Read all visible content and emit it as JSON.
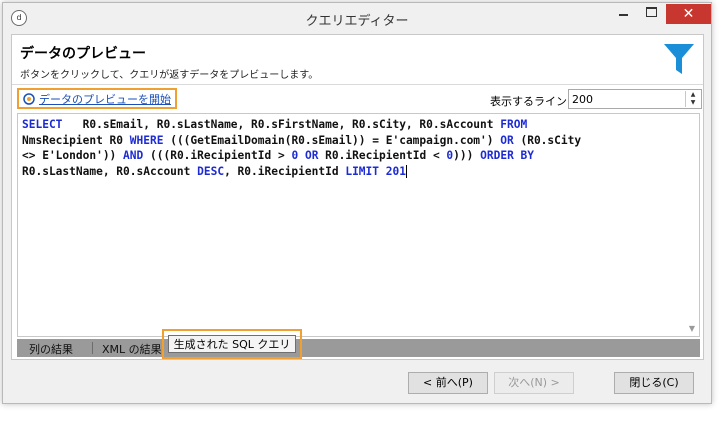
{
  "window": {
    "title": "クエリエディター",
    "app_icon_glyph": "d"
  },
  "header": {
    "title": "データのプレビュー",
    "subtitle": "ボタンをクリックして、クエリが返すデータをプレビューします。",
    "icon": "filter-icon",
    "icon_color": "#1a8fd8"
  },
  "toolbar": {
    "preview_label": "データのプレビューを開始",
    "lines_label": "表示するライン:",
    "lines_value": "200",
    "highlight_color": "#f0a030"
  },
  "sql": {
    "line1_a": "SELECT",
    "line1_b": "   R0.sEmail, R0.sLastName, R0.sFirstName, R0.sCity, R0.sAccount ",
    "line1_c": "FROM",
    "line2_a": "NmsRecipient R0 ",
    "line2_b": "WHERE",
    "line2_c": " (((GetEmailDomain(R0.sEmail)) = E'campaign.com') ",
    "line2_d": "OR",
    "line2_e": " (R0.sCity",
    "line3_a": "<> E'London')) ",
    "line3_b": "AND",
    "line3_c": " (((R0.iRecipientId > ",
    "line3_d": "0",
    "line3_e": " ",
    "line3_f": "OR",
    "line3_g": " R0.iRecipientId < ",
    "line3_h": "0",
    "line3_i": "))) ",
    "line3_j": "ORDER BY",
    "line4_a": "R0.sLastName, R0.sAccount ",
    "line4_b": "DESC",
    "line4_c": ", R0.iRecipientId ",
    "line4_d": "LIMIT",
    "line4_e": " ",
    "line4_f": "201",
    "keyword_color": "#1d2bd4"
  },
  "tabs": [
    {
      "label": "列の結果"
    },
    {
      "label": "XML の結果"
    },
    {
      "label": "生成された SQL クエリ"
    }
  ],
  "footer": {
    "prev_label": "< 前へ(P)",
    "next_label": "次へ(N) >",
    "close_label": "閉じる(C)"
  }
}
